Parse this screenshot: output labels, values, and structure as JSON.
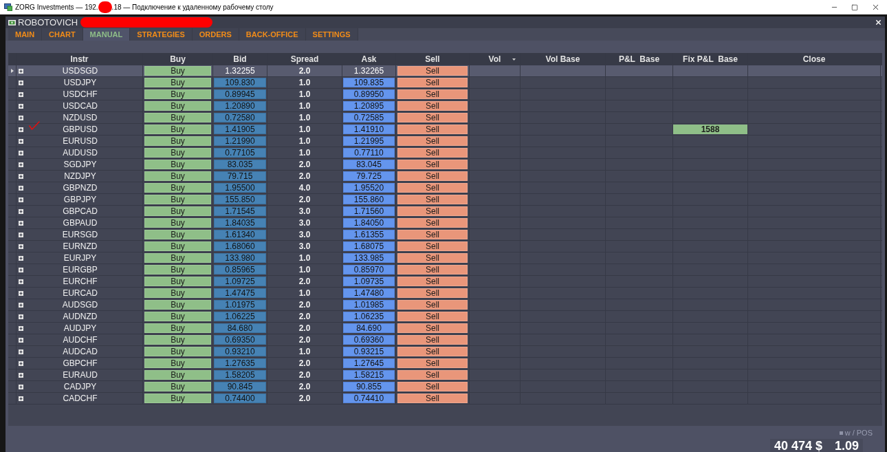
{
  "window": {
    "title_start": "ZORG Investments — 192.",
    "redacted": true,
    "title_end": ".18 — Подключение к удаленному рабочему столу"
  },
  "app": {
    "title": "ROBOTOVICH",
    "redacted": true
  },
  "tabs": [
    {
      "label": "MAIN",
      "selected": false
    },
    {
      "label": "CHART",
      "selected": false
    },
    {
      "label": "MANUAL",
      "selected": true
    },
    {
      "label": "STRATEGIES",
      "selected": false
    },
    {
      "label": "ORDERS",
      "selected": false
    },
    {
      "label": "BACK-OFFICE",
      "selected": false
    },
    {
      "label": "SETTINGS",
      "selected": false
    }
  ],
  "table": {
    "columns": [
      {
        "label": "Instr",
        "dropdown": false
      },
      {
        "label": "Buy",
        "dropdown": false
      },
      {
        "label": "Bid",
        "dropdown": false
      },
      {
        "label": "Spread",
        "dropdown": false
      },
      {
        "label": "Ask",
        "dropdown": false
      },
      {
        "label": "Sell",
        "dropdown": false
      },
      {
        "label": "Vol",
        "dropdown": true
      },
      {
        "label": "Vol Base",
        "dropdown": false
      },
      {
        "label": "P&L  Base",
        "dropdown": false
      },
      {
        "label": "Fix P&L  Base",
        "dropdown": false
      },
      {
        "label": "Close",
        "dropdown": false
      }
    ],
    "rows": [
      {
        "instr": "USDSGD",
        "buy": "Buy",
        "bid": "1.32255",
        "spread": "2.0",
        "ask": "1.32265",
        "sell": "Sell",
        "selected": true,
        "marked": false
      },
      {
        "instr": "USDJPY",
        "buy": "Buy",
        "bid": "109.830",
        "spread": "1.0",
        "ask": "109.835",
        "sell": "Sell",
        "selected": false,
        "marked": false
      },
      {
        "instr": "USDCHF",
        "buy": "Buy",
        "bid": "0.89945",
        "spread": "1.0",
        "ask": "0.89950",
        "sell": "Sell",
        "selected": false,
        "marked": false
      },
      {
        "instr": "USDCAD",
        "buy": "Buy",
        "bid": "1.20890",
        "spread": "1.0",
        "ask": "1.20895",
        "sell": "Sell",
        "selected": false,
        "marked": false
      },
      {
        "instr": "NZDUSD",
        "buy": "Buy",
        "bid": "0.72580",
        "spread": "1.0",
        "ask": "0.72585",
        "sell": "Sell",
        "selected": false,
        "marked": false
      },
      {
        "instr": "GBPUSD",
        "buy": "Buy",
        "bid": "1.41905",
        "spread": "1.0",
        "ask": "1.41910",
        "sell": "Sell",
        "fix_pnl_base": "1588",
        "selected": false,
        "marked": true
      },
      {
        "instr": "EURUSD",
        "buy": "Buy",
        "bid": "1.21990",
        "spread": "1.0",
        "ask": "1.21995",
        "sell": "Sell",
        "selected": false,
        "marked": false
      },
      {
        "instr": "AUDUSD",
        "buy": "Buy",
        "bid": "0.77105",
        "spread": "1.0",
        "ask": "0.77110",
        "sell": "Sell",
        "selected": false,
        "marked": false
      },
      {
        "instr": "SGDJPY",
        "buy": "Buy",
        "bid": "83.035",
        "spread": "2.0",
        "ask": "83.045",
        "sell": "Sell",
        "selected": false,
        "marked": false
      },
      {
        "instr": "NZDJPY",
        "buy": "Buy",
        "bid": "79.715",
        "spread": "2.0",
        "ask": "79.725",
        "sell": "Sell",
        "selected": false,
        "marked": false
      },
      {
        "instr": "GBPNZD",
        "buy": "Buy",
        "bid": "1.95500",
        "spread": "4.0",
        "ask": "1.95520",
        "sell": "Sell",
        "selected": false,
        "marked": false
      },
      {
        "instr": "GBPJPY",
        "buy": "Buy",
        "bid": "155.850",
        "spread": "2.0",
        "ask": "155.860",
        "sell": "Sell",
        "selected": false,
        "marked": false
      },
      {
        "instr": "GBPCAD",
        "buy": "Buy",
        "bid": "1.71545",
        "spread": "3.0",
        "ask": "1.71560",
        "sell": "Sell",
        "selected": false,
        "marked": false
      },
      {
        "instr": "GBPAUD",
        "buy": "Buy",
        "bid": "1.84035",
        "spread": "3.0",
        "ask": "1.84050",
        "sell": "Sell",
        "selected": false,
        "marked": false
      },
      {
        "instr": "EURSGD",
        "buy": "Buy",
        "bid": "1.61340",
        "spread": "3.0",
        "ask": "1.61355",
        "sell": "Sell",
        "selected": false,
        "marked": false
      },
      {
        "instr": "EURNZD",
        "buy": "Buy",
        "bid": "1.68060",
        "spread": "3.0",
        "ask": "1.68075",
        "sell": "Sell",
        "selected": false,
        "marked": false
      },
      {
        "instr": "EURJPY",
        "buy": "Buy",
        "bid": "133.980",
        "spread": "1.0",
        "ask": "133.985",
        "sell": "Sell",
        "selected": false,
        "marked": false
      },
      {
        "instr": "EURGBP",
        "buy": "Buy",
        "bid": "0.85965",
        "spread": "1.0",
        "ask": "0.85970",
        "sell": "Sell",
        "selected": false,
        "marked": false
      },
      {
        "instr": "EURCHF",
        "buy": "Buy",
        "bid": "1.09725",
        "spread": "2.0",
        "ask": "1.09735",
        "sell": "Sell",
        "selected": false,
        "marked": false
      },
      {
        "instr": "EURCAD",
        "buy": "Buy",
        "bid": "1.47475",
        "spread": "1.0",
        "ask": "1.47480",
        "sell": "Sell",
        "selected": false,
        "marked": false
      },
      {
        "instr": "AUDSGD",
        "buy": "Buy",
        "bid": "1.01975",
        "spread": "2.0",
        "ask": "1.01985",
        "sell": "Sell",
        "selected": false,
        "marked": false
      },
      {
        "instr": "AUDNZD",
        "buy": "Buy",
        "bid": "1.06225",
        "spread": "2.0",
        "ask": "1.06235",
        "sell": "Sell",
        "selected": false,
        "marked": false
      },
      {
        "instr": "AUDJPY",
        "buy": "Buy",
        "bid": "84.680",
        "spread": "2.0",
        "ask": "84.690",
        "sell": "Sell",
        "selected": false,
        "marked": false
      },
      {
        "instr": "AUDCHF",
        "buy": "Buy",
        "bid": "0.69350",
        "spread": "2.0",
        "ask": "0.69360",
        "sell": "Sell",
        "selected": false,
        "marked": false
      },
      {
        "instr": "AUDCAD",
        "buy": "Buy",
        "bid": "0.93210",
        "spread": "1.0",
        "ask": "0.93215",
        "sell": "Sell",
        "selected": false,
        "marked": false
      },
      {
        "instr": "GBPCHF",
        "buy": "Buy",
        "bid": "1.27635",
        "spread": "2.0",
        "ask": "1.27645",
        "sell": "Sell",
        "selected": false,
        "marked": false
      },
      {
        "instr": "EURAUD",
        "buy": "Buy",
        "bid": "1.58205",
        "spread": "2.0",
        "ask": "1.58215",
        "sell": "Sell",
        "selected": false,
        "marked": false
      },
      {
        "instr": "CADJPY",
        "buy": "Buy",
        "bid": "90.845",
        "spread": "2.0",
        "ask": "90.855",
        "sell": "Sell",
        "selected": false,
        "marked": false
      },
      {
        "instr": "CADCHF",
        "buy": "Buy",
        "bid": "0.74400",
        "spread": "2.0",
        "ask": "0.74410",
        "sell": "Sell",
        "selected": false,
        "marked": false
      }
    ]
  },
  "footer": {
    "legend": "w / POS",
    "amount": "40 474 $",
    "number": "1.09"
  }
}
